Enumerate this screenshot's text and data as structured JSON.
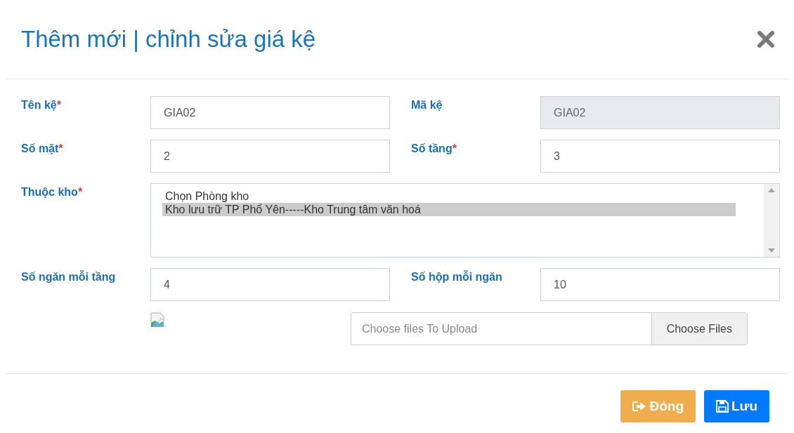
{
  "dialog": {
    "title": "Thêm mới | chỉnh sửa giá kệ"
  },
  "fields": [
    {
      "kind": "text",
      "label": "Tên kệ",
      "required_mark": "*",
      "value": "GIA02",
      "disabled": false
    },
    {
      "kind": "text",
      "label": "Mã kệ",
      "value": "GIA02",
      "disabled": true
    },
    {
      "kind": "text",
      "label": "Số mặt",
      "required_mark": "*",
      "value": "2",
      "disabled": false
    },
    {
      "kind": "text",
      "label": "Số tầng",
      "required_mark": "*",
      "value": "3",
      "disabled": false
    },
    {
      "kind": "listbox",
      "label": "Thuộc kho",
      "required_mark": "*",
      "options": [
        {
          "text": "Chọn Phòng kho",
          "selected": false
        },
        {
          "text": "Kho lưu trữ TP Phổ Yên-----Kho Trung tâm văn hoá",
          "selected": true
        }
      ]
    },
    {
      "kind": "text",
      "label": "Số ngăn mỗi tầng",
      "value": "4",
      "disabled": false
    },
    {
      "kind": "text",
      "label": "Số hộp mỗi ngăn",
      "value": "10",
      "disabled": false
    }
  ],
  "upload": {
    "placeholder": "Choose files To Upload",
    "button": "Choose Files"
  },
  "buttons": [
    {
      "kind": "close",
      "label": "Đóng"
    },
    {
      "kind": "save",
      "label": "Lưu"
    }
  ]
}
